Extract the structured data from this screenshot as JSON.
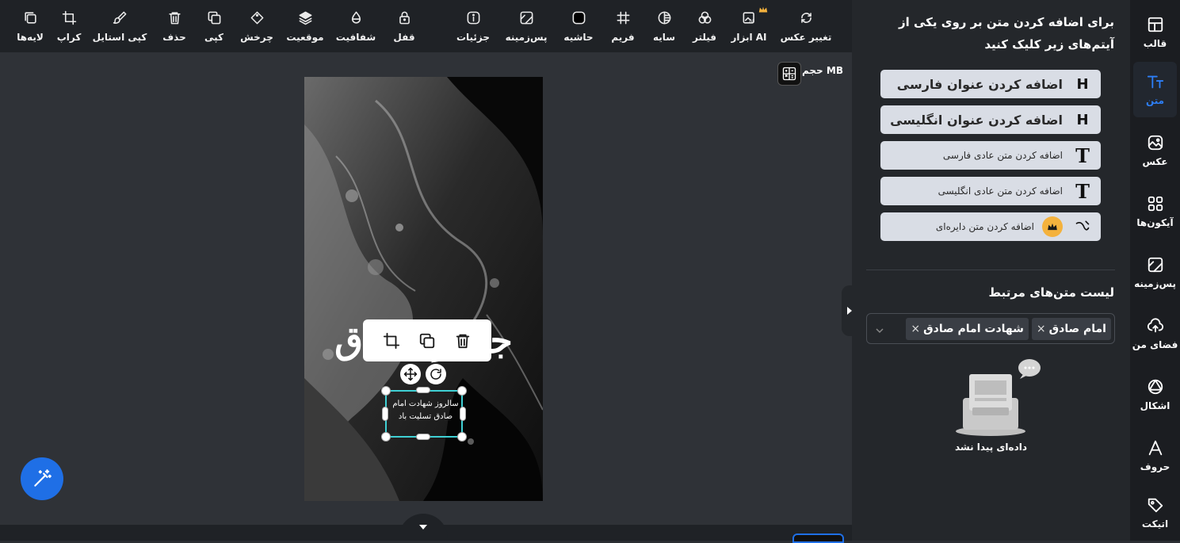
{
  "toolbar": {
    "items": [
      {
        "label": "لایه‌ها",
        "icon": "layers-icon"
      },
      {
        "label": "کراپ",
        "icon": "crop-icon"
      },
      {
        "label": "کپی استایل",
        "icon": "paint-brush-icon"
      },
      {
        "label": "حذف",
        "icon": "trash-icon"
      },
      {
        "label": "کپی",
        "icon": "copy-icon"
      },
      {
        "label": "چرخش",
        "icon": "rotate-icon"
      },
      {
        "label": "موقعیت",
        "icon": "stack-icon"
      },
      {
        "label": "شفافیت",
        "icon": "opacity-icon"
      },
      {
        "label": "قفل",
        "icon": "lock-icon"
      },
      {
        "label": "جزئیات",
        "icon": "info-icon"
      },
      {
        "label": "پس‌زمینه",
        "icon": "background-icon"
      },
      {
        "label": "حاشیه",
        "icon": "border-icon"
      },
      {
        "label": "فریم",
        "icon": "frame-icon"
      },
      {
        "label": "سایه",
        "icon": "shadow-icon"
      },
      {
        "label": "فیلتر",
        "icon": "filter-icon"
      },
      {
        "label": "ابزار AI",
        "icon": "ai-image-icon"
      },
      {
        "label": "تغییر عکس",
        "icon": "replace-image-icon"
      }
    ]
  },
  "canvas": {
    "size_label": "حجم MB",
    "title_calligraphy": "جعفر صادق",
    "small_calligraphy": "سالروز شهادت امام صادق تسلیت باد"
  },
  "panel": {
    "title": "برای اضافه کردن متن بر روی یکی از آیتم‌های زیر کلیک کنید",
    "buttons": [
      {
        "label": "اضافه کردن عنوان فارسی",
        "icon_text": "H",
        "size": "big"
      },
      {
        "label": "اضافه کردن عنوان انگلیسی",
        "icon_text": "H",
        "size": "big"
      },
      {
        "label": "اضافه کردن متن عادی فارسی",
        "icon_text": "T",
        "size": "small"
      },
      {
        "label": "اضافه کردن متن عادی انگلیسی",
        "icon_text": "T",
        "size": "small"
      },
      {
        "label": "اضافه کردن متن دایره‌ای",
        "icon_text": "",
        "size": "small"
      }
    ],
    "related_title": "لیست متن‌های مرتبط",
    "tags": [
      "امام صادق",
      "شهادت امام صادق"
    ],
    "empty_text": "داده‌ای پیدا نشد"
  },
  "sidebar": {
    "items": [
      {
        "label": "قالب",
        "icon": "template-icon"
      },
      {
        "label": "متن",
        "icon": "text-icon",
        "active": true
      },
      {
        "label": "عکس",
        "icon": "photo-icon"
      },
      {
        "label": "آیکون‌ها",
        "icon": "icons-grid-icon"
      },
      {
        "label": "پس‌زمینه",
        "icon": "background-icon"
      },
      {
        "label": "فضای من",
        "icon": "cloud-upload-icon"
      },
      {
        "label": "اشکال",
        "icon": "shapes-icon"
      },
      {
        "label": "حروف",
        "icon": "letter-a-icon"
      },
      {
        "label": "اتیکت",
        "icon": "tag-icon"
      }
    ]
  },
  "colors": {
    "accent": "#2d7ff9",
    "selection": "#3fd0d4",
    "premium": "#f4b23d"
  }
}
